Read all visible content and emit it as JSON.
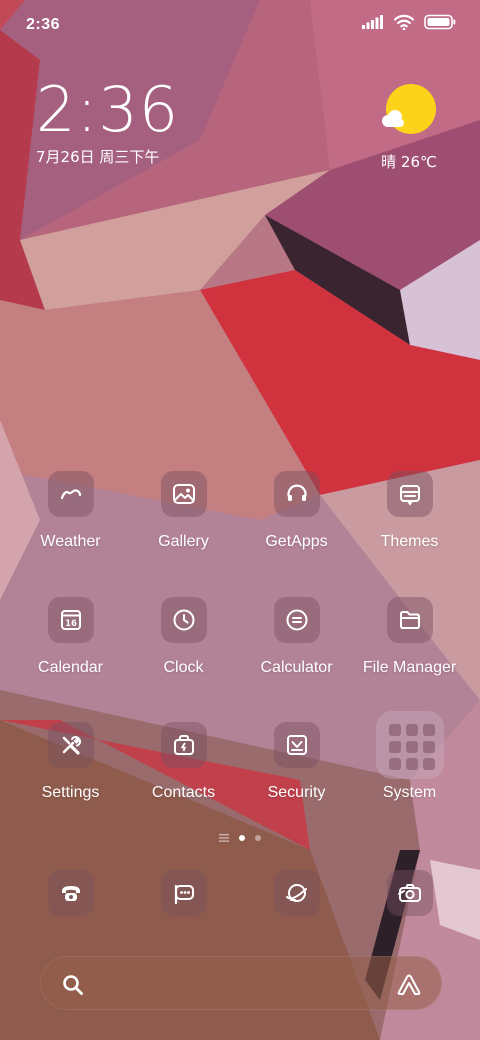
{
  "status_bar": {
    "time": "2:36",
    "signal_icon": "cellular-signal-icon",
    "wifi_icon": "wifi-icon",
    "battery_icon": "battery-icon"
  },
  "clock_widget": {
    "time": "2:36",
    "date": "7月26日 周三下午"
  },
  "weather_widget": {
    "icon": "partly-sunny-icon",
    "text": "晴 26℃"
  },
  "apps": [
    {
      "label": "Weather",
      "icon": "weather-icon"
    },
    {
      "label": "Gallery",
      "icon": "gallery-icon"
    },
    {
      "label": "GetApps",
      "icon": "getapps-icon"
    },
    {
      "label": "Themes",
      "icon": "themes-icon"
    },
    {
      "label": "Calendar",
      "icon": "calendar-icon",
      "badge": "16"
    },
    {
      "label": "Clock",
      "icon": "clock-icon"
    },
    {
      "label": "Calculator",
      "icon": "calculator-icon"
    },
    {
      "label": "File Manager",
      "icon": "file-manager-icon"
    },
    {
      "label": "Settings",
      "icon": "settings-icon"
    },
    {
      "label": "Contacts",
      "icon": "contacts-icon"
    },
    {
      "label": "Security",
      "icon": "security-icon"
    },
    {
      "label": "System",
      "icon": "folder-icon"
    }
  ],
  "page_indicator": {
    "pages": 2,
    "current": 1
  },
  "dock": [
    {
      "icon": "phone-icon"
    },
    {
      "icon": "messages-icon"
    },
    {
      "icon": "browser-icon"
    },
    {
      "icon": "camera-icon"
    }
  ],
  "search_bar": {
    "search_icon": "search-icon",
    "assistant_icon": "assistant-icon"
  },
  "colors": {
    "sun": "#fcd21b",
    "icon_bg": "#78505f"
  }
}
